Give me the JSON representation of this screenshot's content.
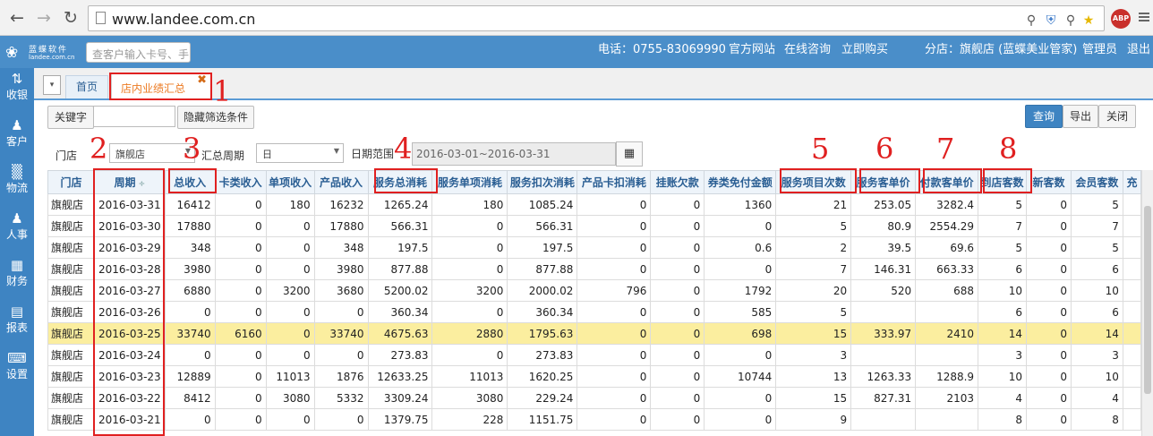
{
  "browser": {
    "url": "www.landee.com.cn",
    "abp_label": "ABP"
  },
  "header": {
    "logo_name": "蓝蝶软件",
    "logo_url": "landee.com.cn",
    "search_placeholder": "查客户输入卡号、手",
    "phone": "电话：0755-83069990",
    "links": [
      "官方网站",
      "在线咨询",
      "立即购买"
    ],
    "branch": "分店：旗舰店 (蓝蝶美业管家)",
    "role": "管理员",
    "logout": "退出"
  },
  "sidebar": {
    "items": [
      {
        "label": "收银",
        "icon": "cashier-icon"
      },
      {
        "label": "客户",
        "icon": "customer-icon"
      },
      {
        "label": "物流",
        "icon": "logistics-icon"
      },
      {
        "label": "人事",
        "icon": "staff-icon"
      },
      {
        "label": "财务",
        "icon": "finance-icon"
      },
      {
        "label": "报表",
        "icon": "report-icon"
      },
      {
        "label": "设置",
        "icon": "settings-icon"
      }
    ]
  },
  "tabs": {
    "toggle": "▾",
    "home": "首页",
    "active": "店内业绩汇总"
  },
  "toolbar": {
    "keyword_label": "关键字",
    "keyword_value": "",
    "hide_filter": "隐藏筛选条件",
    "query": "查询",
    "export": "导出",
    "close": "关闭",
    "store_label": "门店",
    "store_value": "旗舰店",
    "period_label": "汇总周期",
    "period_value": "日",
    "date_label": "日期范围",
    "date_value": "2016-03-01~2016-03-31"
  },
  "annotations": [
    "1",
    "2",
    "3",
    "4",
    "5",
    "6",
    "7",
    "8"
  ],
  "table": {
    "columns": [
      "门店",
      "周期",
      "总收入",
      "卡类收入",
      "单项收入",
      "产品收入",
      "服务总消耗",
      "服务单项消耗",
      "服务扣次消耗",
      "产品卡扣消耗",
      "挂账欠款",
      "券类免付金额",
      "服务项目次数",
      "服务客单价",
      "付款客单价",
      "到店客数",
      "新客数",
      "会员客数",
      "充"
    ],
    "sort_indicator": "÷",
    "rows": [
      [
        "旗舰店",
        "2016-03-31",
        "16412",
        "0",
        "180",
        "16232",
        "1265.24",
        "180",
        "1085.24",
        "0",
        "0",
        "1360",
        "21",
        "253.05",
        "3282.4",
        "5",
        "0",
        "5",
        ""
      ],
      [
        "旗舰店",
        "2016-03-30",
        "17880",
        "0",
        "0",
        "17880",
        "566.31",
        "0",
        "566.31",
        "0",
        "0",
        "0",
        "5",
        "80.9",
        "2554.29",
        "7",
        "0",
        "7",
        ""
      ],
      [
        "旗舰店",
        "2016-03-29",
        "348",
        "0",
        "0",
        "348",
        "197.5",
        "0",
        "197.5",
        "0",
        "0",
        "0.6",
        "2",
        "39.5",
        "69.6",
        "5",
        "0",
        "5",
        ""
      ],
      [
        "旗舰店",
        "2016-03-28",
        "3980",
        "0",
        "0",
        "3980",
        "877.88",
        "0",
        "877.88",
        "0",
        "0",
        "0",
        "7",
        "146.31",
        "663.33",
        "6",
        "0",
        "6",
        ""
      ],
      [
        "旗舰店",
        "2016-03-27",
        "6880",
        "0",
        "3200",
        "3680",
        "5200.02",
        "3200",
        "2000.02",
        "796",
        "0",
        "1792",
        "20",
        "520",
        "688",
        "10",
        "0",
        "10",
        ""
      ],
      [
        "旗舰店",
        "2016-03-26",
        "0",
        "0",
        "0",
        "0",
        "360.34",
        "0",
        "360.34",
        "0",
        "0",
        "585",
        "5",
        "",
        "",
        "6",
        "0",
        "6",
        ""
      ],
      [
        "旗舰店",
        "2016-03-25",
        "33740",
        "6160",
        "0",
        "33740",
        "4675.63",
        "2880",
        "1795.63",
        "0",
        "0",
        "698",
        "15",
        "333.97",
        "2410",
        "14",
        "0",
        "14",
        ""
      ],
      [
        "旗舰店",
        "2016-03-24",
        "0",
        "0",
        "0",
        "0",
        "273.83",
        "0",
        "273.83",
        "0",
        "0",
        "0",
        "3",
        "",
        "",
        "3",
        "0",
        "3",
        ""
      ],
      [
        "旗舰店",
        "2016-03-23",
        "12889",
        "0",
        "11013",
        "1876",
        "12633.25",
        "11013",
        "1620.25",
        "0",
        "0",
        "10744",
        "13",
        "1263.33",
        "1288.9",
        "10",
        "0",
        "10",
        ""
      ],
      [
        "旗舰店",
        "2016-03-22",
        "8412",
        "0",
        "3080",
        "5332",
        "3309.24",
        "3080",
        "229.24",
        "0",
        "0",
        "0",
        "15",
        "827.31",
        "2103",
        "4",
        "0",
        "4",
        ""
      ],
      [
        "旗舰店",
        "2016-03-21",
        "0",
        "0",
        "0",
        "0",
        "1379.75",
        "228",
        "1151.75",
        "0",
        "0",
        "0",
        "9",
        "",
        "",
        "8",
        "0",
        "8",
        ""
      ]
    ],
    "highlight_row": 6
  },
  "colors": {
    "header_bg": "#4a8ec9",
    "sidebar_bg": "#3e84c2",
    "active_tab_text": "#ec7b24",
    "highlight_row": "#fbee9f",
    "annotation_red": "#e02020"
  }
}
